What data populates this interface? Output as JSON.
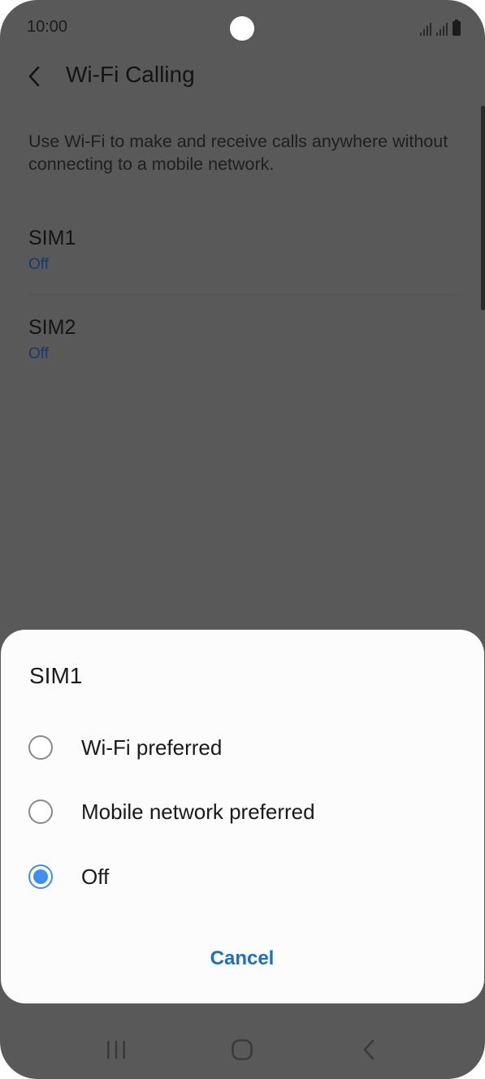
{
  "status_bar": {
    "time": "10:00"
  },
  "header": {
    "title": "Wi-Fi Calling",
    "back_icon": "chevron-left-icon"
  },
  "description": "Use Wi-Fi to make and receive calls anywhere without connecting to a mobile network.",
  "sims": [
    {
      "label": "SIM1",
      "status": "Off"
    },
    {
      "label": "SIM2",
      "status": "Off"
    }
  ],
  "dialog": {
    "title": "SIM1",
    "options": [
      {
        "label": "Wi-Fi preferred",
        "checked": false
      },
      {
        "label": "Mobile network preferred",
        "checked": false
      },
      {
        "label": "Off",
        "checked": true
      }
    ],
    "cancel_label": "Cancel"
  },
  "colors": {
    "accent": "#3e8ef0",
    "link": "#1b6fc4",
    "dimmed_background": "#595959"
  }
}
